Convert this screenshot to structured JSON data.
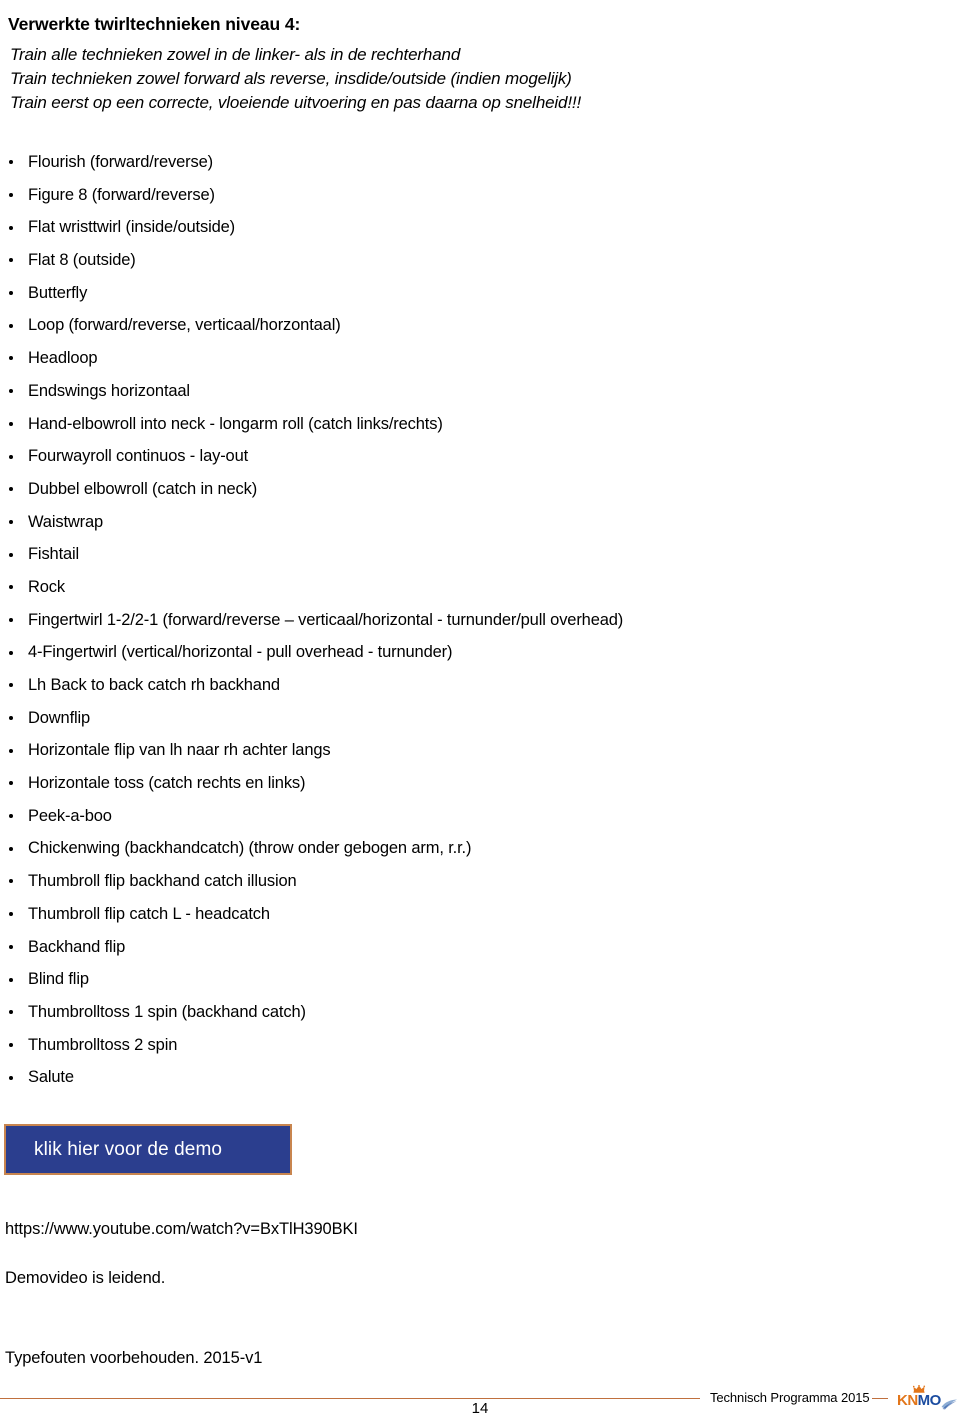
{
  "document": {
    "title": "Verwerkte twirltechnieken niveau 4:",
    "intro": [
      "Train alle technieken zowel in de linker- als in de rechterhand",
      "Train technieken zowel forward als reverse, insdide/outside (indien mogelijk)",
      "Train eerst op een correcte, vloeiende uitvoering en pas daarna op snelheid!!!"
    ],
    "techniques": [
      "Flourish (forward/reverse)",
      "Figure 8 (forward/reverse)",
      "Flat wristtwirl (inside/outside)",
      "Flat 8 (outside)",
      "Butterfly",
      "Loop (forward/reverse, verticaal/horzontaal)",
      "Headloop",
      "Endswings horizontaal",
      "Hand-elbowroll into neck - longarm roll (catch links/rechts)",
      "Fourwayroll continuos  - lay-out",
      "Dubbel elbowroll (catch in neck)",
      "Waistwrap",
      "Fishtail",
      "Rock",
      "Fingertwirl  1-2/2-1  (forward/reverse – verticaal/horizontal - turnunder/pull overhead)",
      "4-Fingertwirl (vertical/horizontal - pull overhead - turnunder)",
      "Lh Back to back catch rh backhand",
      "Downflip",
      "Horizontale flip van lh naar rh achter langs",
      "Horizontale toss (catch rechts en links)",
      "Peek-a-boo",
      "Chickenwing (backhandcatch) (throw onder gebogen arm, r.r.)",
      "Thumbroll flip backhand catch illusion",
      "Thumbroll flip catch L - headcatch",
      "Backhand flip",
      "Blind flip",
      "Thumbrolltoss 1 spin (backhand catch)",
      "Thumbrolltoss 2 spin",
      "Salute"
    ],
    "demo_button": {
      "label": "klik hier voor de demo",
      "background": "#2B3E8E",
      "border_color": "#C8854F",
      "text_color": "#FFFFFF"
    },
    "video_url": "https://www.youtube.com/watch?v=BxTlH390BKI",
    "note_demo": "Demovideo is leidend.",
    "note_typos": "Typefouten voorbehouden. 2015-v1"
  },
  "footer": {
    "label": "Technisch Programma 2015",
    "page_number": "14",
    "rule_color": "#C0703E",
    "logo": {
      "part1": "KN",
      "part2": "MO",
      "part1_color": "#E2761B",
      "part2_color": "#1B4CA0"
    }
  }
}
